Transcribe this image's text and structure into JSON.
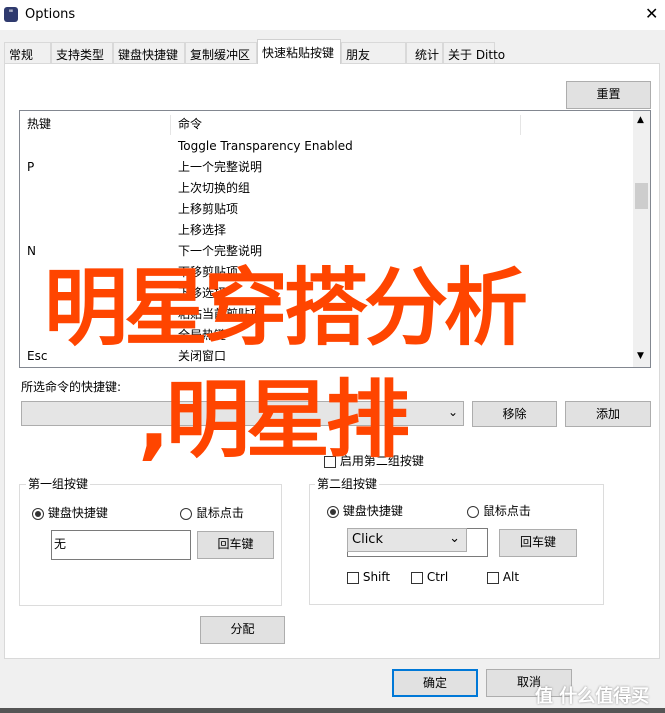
{
  "window": {
    "title": "Options",
    "close": "✕"
  },
  "tabs": [
    "常规",
    "支持类型",
    "键盘快捷键",
    "复制缓冲区",
    "快速粘贴按键",
    "朋友",
    "统计",
    "关于 Ditto"
  ],
  "reset_label": "重置",
  "list": {
    "headers": [
      "热键",
      "命令"
    ],
    "rows": [
      [
        "",
        "Toggle Transparency Enabled"
      ],
      [
        "P",
        "上一个完整说明"
      ],
      [
        "",
        "上次切换的组"
      ],
      [
        "",
        "上移剪贴项"
      ],
      [
        "",
        "上移选择"
      ],
      [
        "N",
        "下一个完整说明"
      ],
      [
        "",
        "下移剪贴项"
      ],
      [
        "",
        "下移选择"
      ],
      [
        "",
        "粘贴当前剪贴项"
      ],
      [
        "",
        "全局热键"
      ],
      [
        "Esc",
        "关闭窗口"
      ]
    ]
  },
  "selected_label": "所选命令的快捷键:",
  "remove_label": "移除",
  "add_label": "添加",
  "enable_second": "启用第二组按键",
  "group1": {
    "title": "第一组按键",
    "radio_kb": "键盘快捷键",
    "radio_mouse": "鼠标点击",
    "value": "无",
    "enter": "回车键"
  },
  "group2": {
    "title": "第二组按键",
    "radio_kb": "键盘快捷键",
    "radio_mouse": "鼠标点击",
    "select": "Click",
    "enter": "回车键",
    "shift": "Shift",
    "ctrl": "Ctrl",
    "alt": "Alt"
  },
  "assign_label": "分配",
  "ok_label": "确定",
  "cancel_label": "取消",
  "overlay": {
    "line1": "明星穿搭分析",
    "line2": ",明星排",
    "color": "#ff4500"
  },
  "watermark": "值 什么值得买"
}
